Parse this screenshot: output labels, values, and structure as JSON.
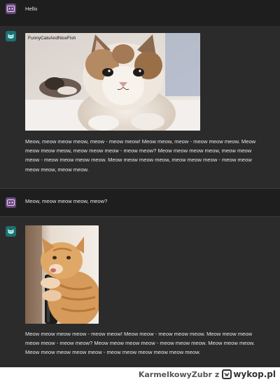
{
  "conversation": [
    {
      "role": "user",
      "text": "Hello"
    },
    {
      "role": "assistant",
      "image": {
        "caption": "FunnyCatsAndNiceFish",
        "subject": "kitten-photo"
      },
      "text": "Meow, meow meow meow, meow - meow meow! Meow meow, meow - meow meow meow. Meow meow meow meow, meow meow meow - meow meow? Meow meow meow meow, meow meow meow - meow meow meow meow. Meow meow meow meow, meow meow meow - meow meow meow meow, meow meow."
    },
    {
      "role": "user",
      "text": "Meow, meow meow meow, meow?"
    },
    {
      "role": "assistant",
      "image": {
        "caption": "",
        "subject": "cat-hugging-vacuum-photo"
      },
      "text": "Meow meow meow meow - meow meow! Meow meow - meow meow meow. Meow meow meow meow meow - meow meow? Meow meow meow meow - meow meow meow. Meow meow meow. Meow meow meow meow meow - meow meow meow meow meow meow."
    }
  ],
  "watermark": {
    "user": "KarmelkowyZubr",
    "separator": "z",
    "site": "wykop.pl"
  },
  "colors": {
    "user_bg": "#1e1e1e",
    "bot_bg": "#2b2b2b",
    "user_avatar": "#6b4a7a",
    "bot_avatar": "#1e6f70"
  }
}
